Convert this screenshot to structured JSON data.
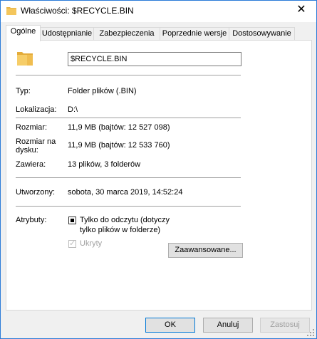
{
  "window": {
    "title": "Właściwości: $RECYCLE.BIN",
    "close_glyph": "✕"
  },
  "tabs": [
    {
      "label": "Ogólne"
    },
    {
      "label": "Udostępnianie"
    },
    {
      "label": "Zabezpieczenia"
    },
    {
      "label": "Poprzednie wersje"
    },
    {
      "label": "Dostosowywanie"
    }
  ],
  "general": {
    "name_value": "$RECYCLE.BIN",
    "type_label": "Typ:",
    "type_value": "Folder plików (.BIN)",
    "location_label": "Lokalizacja:",
    "location_value": "D:\\",
    "size_label": "Rozmiar:",
    "size_value": "11,9 MB (bajtów: 12 527 098)",
    "size_on_disk_label_1": "Rozmiar na",
    "size_on_disk_label_2": "dysku:",
    "size_on_disk_value": "11,9 MB (bajtów: 12 533 760)",
    "contains_label": "Zawiera:",
    "contains_value": "13 plików, 3 folderów",
    "created_label": "Utworzony:",
    "created_value": "sobota, 30 marca 2019, 14:52:24",
    "attributes_label": "Atrybuty:",
    "readonly_label_1": "Tylko do odczytu (dotyczy",
    "readonly_label_2": "tylko plików w folderze)",
    "hidden_label": "Ukryty",
    "advanced_button": "Zaawansowane..."
  },
  "footer": {
    "ok": "OK",
    "cancel": "Anuluj",
    "apply": "Zastosuj"
  },
  "colors": {
    "accent": "#0078d7",
    "folder": "#f4c65c",
    "border": "#2b7bd8"
  }
}
